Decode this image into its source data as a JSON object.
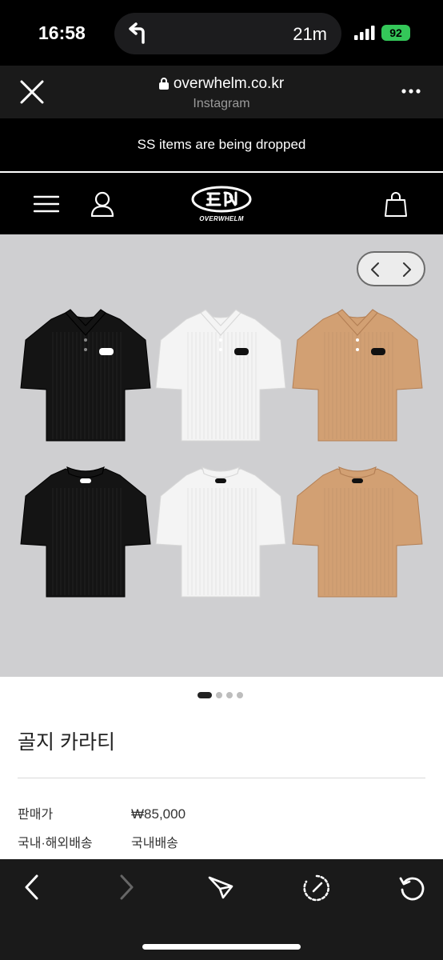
{
  "status_bar": {
    "time": "16:58",
    "navigation_distance": "21m",
    "battery": "92"
  },
  "browser": {
    "url": "overwhelm.co.kr",
    "source": "Instagram"
  },
  "announcement": "SS items are being dropped",
  "site_nav": {
    "logo_text": "OVERWHELM"
  },
  "gallery": {
    "shirts": [
      {
        "color": "#141414",
        "view": "front"
      },
      {
        "color": "#f4f4f4",
        "view": "front"
      },
      {
        "color": "#d2a073",
        "view": "front"
      },
      {
        "color": "#141414",
        "view": "back"
      },
      {
        "color": "#f4f4f4",
        "view": "back"
      },
      {
        "color": "#d2a073",
        "view": "back"
      }
    ],
    "slide_count": 4,
    "active_slide": 1
  },
  "product": {
    "title": "골지 카라티",
    "price_label": "판매가",
    "price_value": "₩85,000",
    "shipping_label": "국내·해외배송",
    "shipping_value": "국내배송"
  },
  "toolbar": {
    "icons": [
      "back-icon",
      "forward-icon",
      "share-icon",
      "compass-icon",
      "reload-icon"
    ]
  }
}
